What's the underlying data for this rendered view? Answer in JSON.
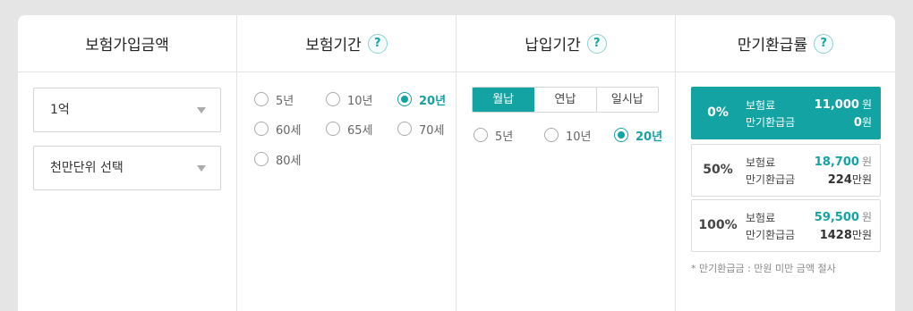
{
  "columns": {
    "amount": {
      "title": "보험가입금액"
    },
    "period": {
      "title": "보험기간",
      "help": "?"
    },
    "payment": {
      "title": "납입기간",
      "help": "?"
    },
    "refund": {
      "title": "만기환급률",
      "help": "?"
    }
  },
  "amount": {
    "primary_select": "1억",
    "secondary_select": "천만단위 선택"
  },
  "period_options": [
    "5년",
    "10년",
    "20년",
    "60세",
    "65세",
    "70세",
    "80세"
  ],
  "period_selected": "20년",
  "payment_tabs": [
    "월납",
    "연납",
    "일시납"
  ],
  "payment_tab_active": "월납",
  "payment_options": [
    "5년",
    "10년",
    "20년"
  ],
  "payment_selected": "20년",
  "refund_rows": [
    {
      "pct": "0%",
      "premium_label": "보험료",
      "premium": "11,000",
      "premium_unit": "원",
      "refund_label": "만기환급금",
      "refund": "0",
      "refund_unit": "원"
    },
    {
      "pct": "50%",
      "premium_label": "보험료",
      "premium": "18,700",
      "premium_unit": "원",
      "refund_label": "만기환급금",
      "refund": "224",
      "refund_unit": "만원"
    },
    {
      "pct": "100%",
      "premium_label": "보험료",
      "premium": "59,500",
      "premium_unit": "원",
      "refund_label": "만기환급금",
      "refund": "1428",
      "refund_unit": "만원"
    }
  ],
  "refund_active": "0%",
  "refund_note": "* 만기환급금 : 만원 미만 금액 절사",
  "colors": {
    "accent": "#14a3a3"
  }
}
